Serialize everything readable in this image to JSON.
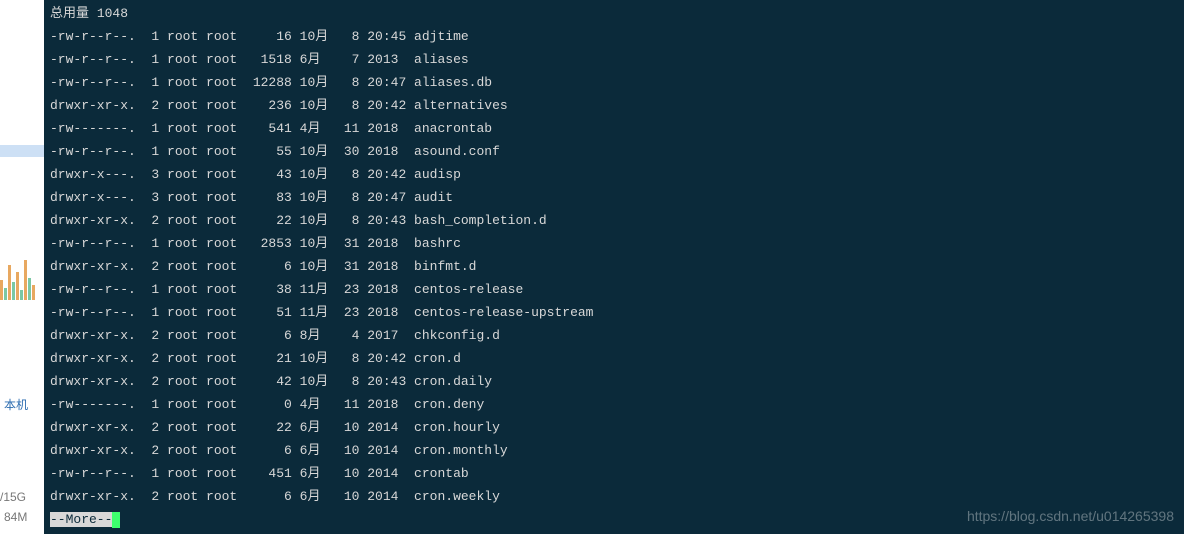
{
  "sidebar": {
    "label_local": "本机",
    "disk": "/15G",
    "mem": "84M"
  },
  "terminal": {
    "total_label": "总用量",
    "total_value": "1048",
    "more_label": "--More--",
    "watermark": "https://blog.csdn.net/u014265398",
    "rows": [
      {
        "perm": "-rw-r--r--.",
        "links": "1",
        "owner": "root",
        "group": "root",
        "size": "16",
        "month": "10月",
        "day": "8",
        "time": "20:45",
        "name": "adjtime"
      },
      {
        "perm": "-rw-r--r--.",
        "links": "1",
        "owner": "root",
        "group": "root",
        "size": "1518",
        "month": "6月",
        "day": "7",
        "time": "2013",
        "name": "aliases"
      },
      {
        "perm": "-rw-r--r--.",
        "links": "1",
        "owner": "root",
        "group": "root",
        "size": "12288",
        "month": "10月",
        "day": "8",
        "time": "20:47",
        "name": "aliases.db"
      },
      {
        "perm": "drwxr-xr-x.",
        "links": "2",
        "owner": "root",
        "group": "root",
        "size": "236",
        "month": "10月",
        "day": "8",
        "time": "20:42",
        "name": "alternatives"
      },
      {
        "perm": "-rw-------.",
        "links": "1",
        "owner": "root",
        "group": "root",
        "size": "541",
        "month": "4月",
        "day": "11",
        "time": "2018",
        "name": "anacrontab"
      },
      {
        "perm": "-rw-r--r--.",
        "links": "1",
        "owner": "root",
        "group": "root",
        "size": "55",
        "month": "10月",
        "day": "30",
        "time": "2018",
        "name": "asound.conf"
      },
      {
        "perm": "drwxr-x---.",
        "links": "3",
        "owner": "root",
        "group": "root",
        "size": "43",
        "month": "10月",
        "day": "8",
        "time": "20:42",
        "name": "audisp"
      },
      {
        "perm": "drwxr-x---.",
        "links": "3",
        "owner": "root",
        "group": "root",
        "size": "83",
        "month": "10月",
        "day": "8",
        "time": "20:47",
        "name": "audit"
      },
      {
        "perm": "drwxr-xr-x.",
        "links": "2",
        "owner": "root",
        "group": "root",
        "size": "22",
        "month": "10月",
        "day": "8",
        "time": "20:43",
        "name": "bash_completion.d"
      },
      {
        "perm": "-rw-r--r--.",
        "links": "1",
        "owner": "root",
        "group": "root",
        "size": "2853",
        "month": "10月",
        "day": "31",
        "time": "2018",
        "name": "bashrc"
      },
      {
        "perm": "drwxr-xr-x.",
        "links": "2",
        "owner": "root",
        "group": "root",
        "size": "6",
        "month": "10月",
        "day": "31",
        "time": "2018",
        "name": "binfmt.d"
      },
      {
        "perm": "-rw-r--r--.",
        "links": "1",
        "owner": "root",
        "group": "root",
        "size": "38",
        "month": "11月",
        "day": "23",
        "time": "2018",
        "name": "centos-release"
      },
      {
        "perm": "-rw-r--r--.",
        "links": "1",
        "owner": "root",
        "group": "root",
        "size": "51",
        "month": "11月",
        "day": "23",
        "time": "2018",
        "name": "centos-release-upstream"
      },
      {
        "perm": "drwxr-xr-x.",
        "links": "2",
        "owner": "root",
        "group": "root",
        "size": "6",
        "month": "8月",
        "day": "4",
        "time": "2017",
        "name": "chkconfig.d"
      },
      {
        "perm": "drwxr-xr-x.",
        "links": "2",
        "owner": "root",
        "group": "root",
        "size": "21",
        "month": "10月",
        "day": "8",
        "time": "20:42",
        "name": "cron.d"
      },
      {
        "perm": "drwxr-xr-x.",
        "links": "2",
        "owner": "root",
        "group": "root",
        "size": "42",
        "month": "10月",
        "day": "8",
        "time": "20:43",
        "name": "cron.daily"
      },
      {
        "perm": "-rw-------.",
        "links": "1",
        "owner": "root",
        "group": "root",
        "size": "0",
        "month": "4月",
        "day": "11",
        "time": "2018",
        "name": "cron.deny"
      },
      {
        "perm": "drwxr-xr-x.",
        "links": "2",
        "owner": "root",
        "group": "root",
        "size": "22",
        "month": "6月",
        "day": "10",
        "time": "2014",
        "name": "cron.hourly"
      },
      {
        "perm": "drwxr-xr-x.",
        "links": "2",
        "owner": "root",
        "group": "root",
        "size": "6",
        "month": "6月",
        "day": "10",
        "time": "2014",
        "name": "cron.monthly"
      },
      {
        "perm": "-rw-r--r--.",
        "links": "1",
        "owner": "root",
        "group": "root",
        "size": "451",
        "month": "6月",
        "day": "10",
        "time": "2014",
        "name": "crontab"
      },
      {
        "perm": "drwxr-xr-x.",
        "links": "2",
        "owner": "root",
        "group": "root",
        "size": "6",
        "month": "6月",
        "day": "10",
        "time": "2014",
        "name": "cron.weekly"
      }
    ]
  }
}
